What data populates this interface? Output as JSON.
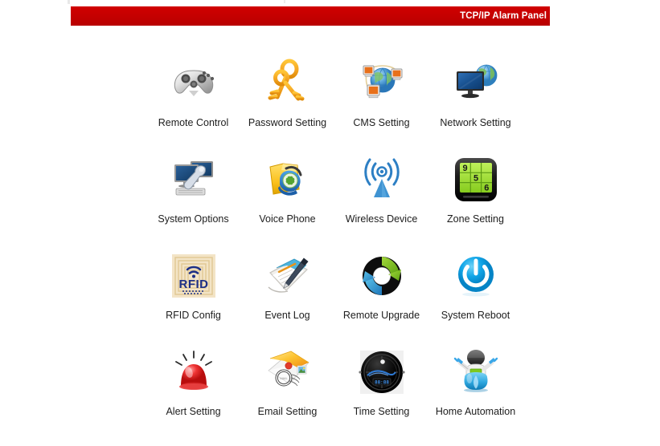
{
  "header": {
    "title": "TCP/IP Alarm Panel",
    "bar_color": "#cc0000",
    "text_color": "#ffffff"
  },
  "menu": {
    "columns": 4,
    "rows": 4,
    "items": [
      {
        "label": "Remote Control",
        "icon": "gamepad-icon"
      },
      {
        "label": "Password Setting",
        "icon": "keys-icon"
      },
      {
        "label": "CMS Setting",
        "icon": "network-globe-computers-icon"
      },
      {
        "label": "Network Setting",
        "icon": "monitor-globe-icon"
      },
      {
        "label": "System Options",
        "icon": "monitors-wrench-icon"
      },
      {
        "label": "Voice Phone",
        "icon": "folder-phone-icon"
      },
      {
        "label": "Wireless Device",
        "icon": "antenna-signal-icon"
      },
      {
        "label": "Zone Setting",
        "icon": "keypad-grid-icon"
      },
      {
        "label": "RFID Config",
        "icon": "rfid-tag-icon"
      },
      {
        "label": "Event Log",
        "icon": "notepad-pen-icon"
      },
      {
        "label": "Remote Upgrade",
        "icon": "circular-arrows-icon"
      },
      {
        "label": "System Reboot",
        "icon": "power-button-icon"
      },
      {
        "label": "Alert Setting",
        "icon": "siren-light-icon"
      },
      {
        "label": "Email Setting",
        "icon": "envelope-stamp-icon"
      },
      {
        "label": "Time Setting",
        "icon": "watch-clock-icon"
      },
      {
        "label": "Home Automation",
        "icon": "robot-icon"
      }
    ]
  },
  "icon_texts": {
    "rfid_label": "RFID",
    "zone_keys": [
      "9",
      "5",
      "6"
    ]
  }
}
